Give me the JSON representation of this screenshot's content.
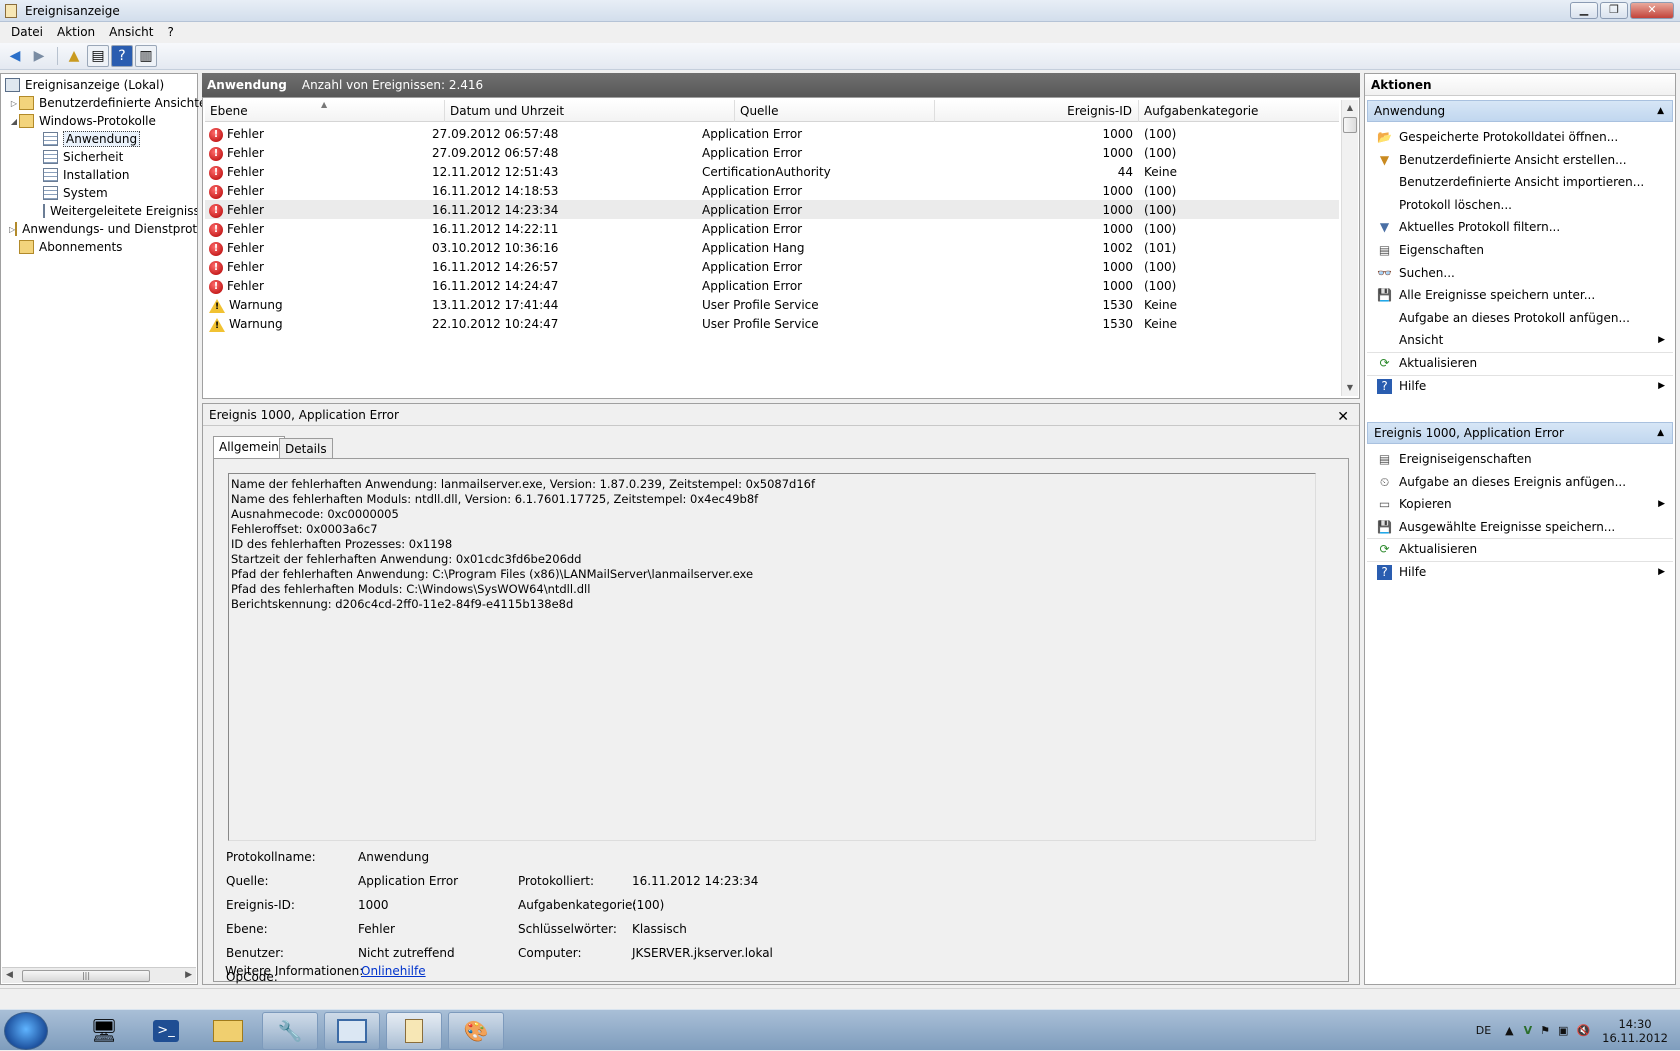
{
  "window": {
    "title": "Ereignisanzeige"
  },
  "menu": [
    "Datei",
    "Aktion",
    "Ansicht",
    "?"
  ],
  "tree": {
    "root": "Ereignisanzeige (Lokal)",
    "custom_views": "Benutzerdefinierte Ansichten",
    "windows_logs": "Windows-Protokolle",
    "logs": [
      "Anwendung",
      "Sicherheit",
      "Installation",
      "System",
      "Weitergeleitete Ereignisse"
    ],
    "apps_services": "Anwendungs- und Dienstprotokolle",
    "subscriptions": "Abonnements"
  },
  "loghead": {
    "name": "Anwendung",
    "count": "Anzahl von Ereignissen: 2.416"
  },
  "columns": [
    "Ebene",
    "Datum und Uhrzeit",
    "Quelle",
    "Ereignis-ID",
    "Aufgabenkategorie"
  ],
  "rows": [
    {
      "level": "Fehler",
      "type": "error",
      "date": "27.09.2012 06:57:48",
      "source": "Application Error",
      "id": "1000",
      "cat": "(100)"
    },
    {
      "level": "Fehler",
      "type": "error",
      "date": "27.09.2012 06:57:48",
      "source": "Application Error",
      "id": "1000",
      "cat": "(100)"
    },
    {
      "level": "Fehler",
      "type": "error",
      "date": "12.11.2012 12:51:43",
      "source": "CertificationAuthority",
      "id": "44",
      "cat": "Keine"
    },
    {
      "level": "Fehler",
      "type": "error",
      "date": "16.11.2012 14:18:53",
      "source": "Application Error",
      "id": "1000",
      "cat": "(100)"
    },
    {
      "level": "Fehler",
      "type": "error",
      "date": "16.11.2012 14:23:34",
      "source": "Application Error",
      "id": "1000",
      "cat": "(100)",
      "selected": true
    },
    {
      "level": "Fehler",
      "type": "error",
      "date": "16.11.2012 14:22:11",
      "source": "Application Error",
      "id": "1000",
      "cat": "(100)"
    },
    {
      "level": "Fehler",
      "type": "error",
      "date": "03.10.2012 10:36:16",
      "source": "Application Hang",
      "id": "1002",
      "cat": "(101)"
    },
    {
      "level": "Fehler",
      "type": "error",
      "date": "16.11.2012 14:26:57",
      "source": "Application Error",
      "id": "1000",
      "cat": "(100)"
    },
    {
      "level": "Fehler",
      "type": "error",
      "date": "16.11.2012 14:24:47",
      "source": "Application Error",
      "id": "1000",
      "cat": "(100)"
    },
    {
      "level": "Warnung",
      "type": "warn",
      "date": "13.11.2012 17:41:44",
      "source": "User Profile Service",
      "id": "1530",
      "cat": "Keine"
    },
    {
      "level": "Warnung",
      "type": "warn",
      "date": "22.10.2012 10:24:47",
      "source": "User Profile Service",
      "id": "1530",
      "cat": "Keine"
    }
  ],
  "detail": {
    "title": "Ereignis 1000, Application Error",
    "tabs": [
      "Allgemein",
      "Details"
    ],
    "lines": [
      "Name der fehlerhaften Anwendung: lanmailserver.exe, Version: 1.87.0.239, Zeitstempel: 0x5087d16f",
      "Name des fehlerhaften Moduls: ntdll.dll, Version: 6.1.7601.17725, Zeitstempel: 0x4ec49b8f",
      "Ausnahmecode: 0xc0000005",
      "Fehleroffset: 0x0003a6c7",
      "ID des fehlerhaften Prozesses: 0x1198",
      "Startzeit der fehlerhaften Anwendung: 0x01cdc3fd6be206dd",
      "Pfad der fehlerhaften Anwendung: C:\\Program Files (x86)\\LANMailServer\\lanmailserver.exe",
      "Pfad des fehlerhaften Moduls: C:\\Windows\\SysWOW64\\ntdll.dll",
      "Berichtskennung: d206c4cd-2ff0-11e2-84f9-e4115b138e8d"
    ],
    "props": {
      "log_label": "Protokollname:",
      "log": "Anwendung",
      "source_label": "Quelle:",
      "source": "Application Error",
      "logged_label": "Protokolliert:",
      "logged": "16.11.2012 14:23:34",
      "id_label": "Ereignis-ID:",
      "id": "1000",
      "cat_label": "Aufgabenkategorie:",
      "cat": "(100)",
      "level_label": "Ebene:",
      "level": "Fehler",
      "kw_label": "Schlüsselwörter:",
      "kw": "Klassisch",
      "user_label": "Benutzer:",
      "user": "Nicht zutreffend",
      "computer_label": "Computer:",
      "computer": "JKSERVER.jkserver.lokal",
      "opcode_label": "OpCode:",
      "more_label": "Weitere Informationen:",
      "more_link": "Onlinehilfe"
    }
  },
  "actions": {
    "title": "Aktionen",
    "sec1": "Anwendung",
    "items1": [
      "Gespeicherte Protokolldatei öffnen...",
      "Benutzerdefinierte Ansicht erstellen...",
      "Benutzerdefinierte Ansicht importieren...",
      "Protokoll löschen...",
      "Aktuelles Protokoll filtern...",
      "Eigenschaften",
      "Suchen...",
      "Alle Ereignisse speichern unter...",
      "Aufgabe an dieses Protokoll anfügen...",
      "Ansicht",
      "Aktualisieren",
      "Hilfe"
    ],
    "sec2": "Ereignis 1000, Application Error",
    "items2": [
      "Ereigniseigenschaften",
      "Aufgabe an dieses Ereignis anfügen...",
      "Kopieren",
      "Ausgewählte Ereignisse speichern...",
      "Aktualisieren",
      "Hilfe"
    ]
  },
  "taskbar": {
    "lang": "DE",
    "time": "14:30",
    "date": "16.11.2012"
  }
}
